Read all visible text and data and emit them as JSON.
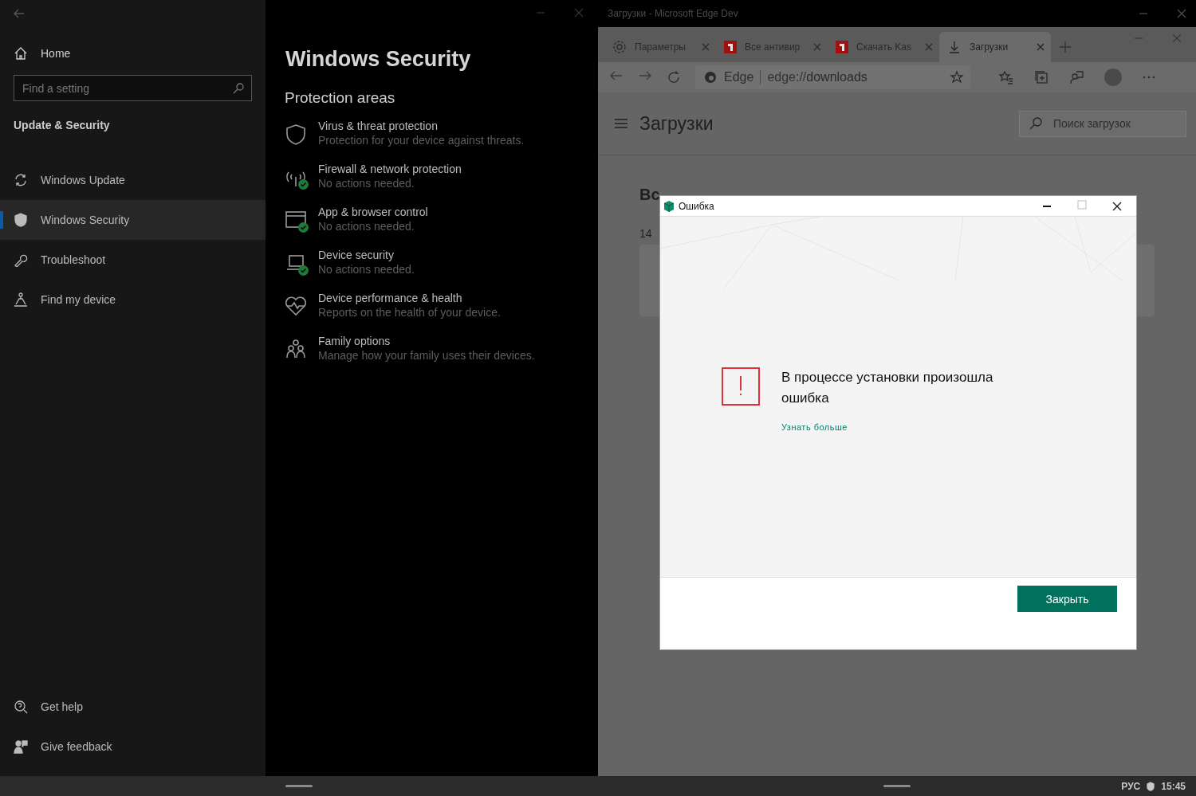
{
  "settings": {
    "home": "Home",
    "search": {
      "placeholder": "Find a setting"
    },
    "section": "Update & Security",
    "nav": [
      {
        "label": "Windows Update",
        "selected": false
      },
      {
        "label": "Windows Security",
        "selected": true
      },
      {
        "label": "Troubleshoot",
        "selected": false
      },
      {
        "label": "Find my device",
        "selected": false
      }
    ],
    "footer": [
      {
        "label": "Get help"
      },
      {
        "label": "Give feedback"
      }
    ]
  },
  "security": {
    "title": "Windows Security",
    "section": "Protection areas",
    "areas": [
      {
        "title": "Virus & threat protection",
        "subtitle": "Protection for your device against threats.",
        "ok": false
      },
      {
        "title": "Firewall & network protection",
        "subtitle": "No actions needed.",
        "ok": true
      },
      {
        "title": "App & browser control",
        "subtitle": "No actions needed.",
        "ok": true
      },
      {
        "title": "Device security",
        "subtitle": "No actions needed.",
        "ok": true
      },
      {
        "title": "Device performance & health",
        "subtitle": "Reports on the health of your device.",
        "ok": false
      },
      {
        "title": "Family options",
        "subtitle": "Manage how your family uses their devices.",
        "ok": false
      }
    ]
  },
  "edge": {
    "title": "Загрузки - Microsoft Edge Dev",
    "tabs": [
      {
        "label": "Параметры",
        "kind": "settings",
        "selected": false
      },
      {
        "label": "Все антивир",
        "kind": "site",
        "selected": false
      },
      {
        "label": "Скачать Kas",
        "kind": "site",
        "selected": false
      },
      {
        "label": "Загрузки",
        "kind": "downloads",
        "selected": true
      }
    ],
    "address": {
      "site": "Edge",
      "scheme": "edge://",
      "path": "downloads"
    },
    "page": {
      "title": "Загрузки",
      "search": {
        "placeholder": "Поиск загрузок"
      },
      "heading": "Вс",
      "count": "14"
    }
  },
  "dialog": {
    "title": "Ошибка",
    "message": "В процессе установки произошла ошибка",
    "link": "Узнать больше",
    "button": "Закрыть"
  },
  "taskbar": {
    "language": "РУС",
    "time": "15:45"
  }
}
